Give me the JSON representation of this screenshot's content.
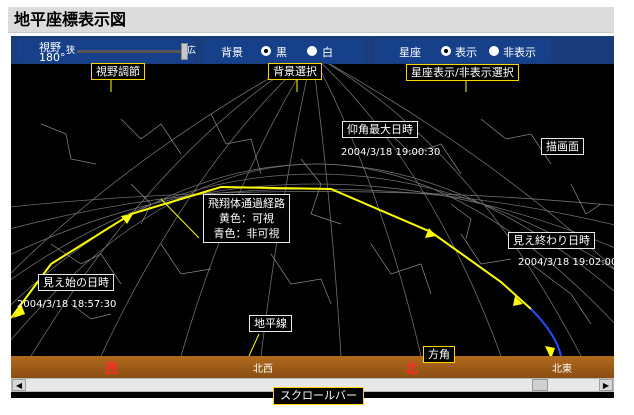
{
  "title": "地平座標表示図",
  "controls": {
    "fov": {
      "label": "視野",
      "value": "180°",
      "narrow": "狭",
      "wide": "広",
      "level": 0.95
    },
    "background": {
      "label": "背景",
      "options": [
        "黒",
        "白"
      ],
      "selected": "黒"
    },
    "constellation": {
      "label": "星座",
      "options": [
        "表示",
        "非表示"
      ],
      "selected": "表示"
    }
  },
  "annotations": {
    "fov_adjust": "視野調節",
    "background_select": "背景選択",
    "constellation_select": "星座表示/非表示選択",
    "max_elevation": "仰角最大日時",
    "max_elevation_time": "2004/3/18 19:00:30",
    "drawing_surface": "描画面",
    "path_title": "飛翔体通過経路",
    "path_yellow": "黄色：可視",
    "path_blue": "青色：非可視",
    "visible_end": "見え終わり日時",
    "visible_end_time": "2004/3/18 19:02:00",
    "visible_start": "見え始の日時",
    "visible_start_time": "2004/3/18 18:57:30",
    "horizon_line": "地平線",
    "direction": "方角",
    "scrollbar": "スクロールバー"
  },
  "compass": {
    "west": "西",
    "northwest": "北西",
    "north": "北",
    "northeast": "北東"
  },
  "colors": {
    "visible_path": "#ffff00",
    "invisible_path": "#1e50ff",
    "control_bar": "#1b3c7a",
    "horizon": "#a0601a",
    "cardinal": "#ff2a2a"
  },
  "scrollbar": {
    "position": 0.91
  }
}
